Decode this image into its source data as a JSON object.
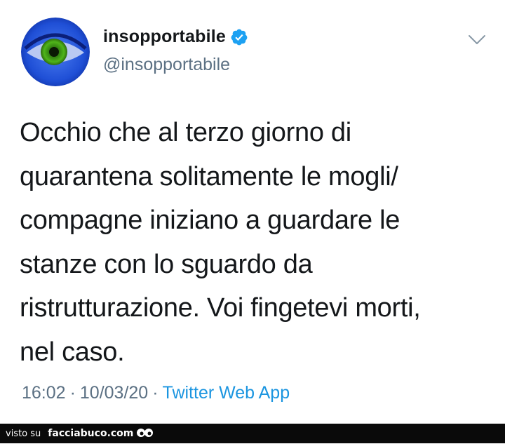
{
  "tweet": {
    "display_name": "insopportabile",
    "verified_icon": "verified-badge-icon",
    "handle": "@insopportabile",
    "text": "Occhio che al terzo giorno di\nquarantena solitamente le mogli/\ncompagne iniziano a guardare le\nstanze con lo sguardo da\nristrutturazione. Voi fingetevi morti,\nnel caso.",
    "time": "16:02",
    "date": "10/03/20",
    "separator": "·",
    "source": "Twitter Web App"
  },
  "footer": {
    "visto_label": "visto su",
    "site_name": "facciabuco.com"
  },
  "colors": {
    "text": "#14171a",
    "secondary": "#5b7083",
    "link": "#1b95e0",
    "verified": "#1da1f2",
    "footer_bg": "#0a0a0a"
  }
}
